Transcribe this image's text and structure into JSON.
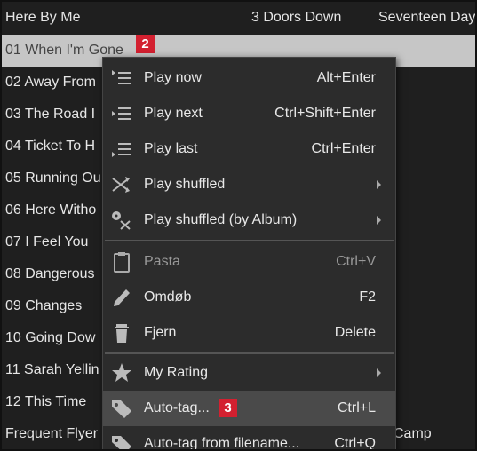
{
  "header": {
    "title": "Here By Me",
    "artist": "3 Doors Down",
    "album": "Seventeen Days"
  },
  "tracks": [
    {
      "title": "01 When I'm Gone"
    },
    {
      "title": "02 Away From"
    },
    {
      "title": "03 The Road I"
    },
    {
      "title": "04 Ticket To H"
    },
    {
      "title": "05 Running Ou"
    },
    {
      "title": "06 Here Witho"
    },
    {
      "title": "07 I Feel You"
    },
    {
      "title": "08 Dangerous"
    },
    {
      "title": "09 Changes"
    },
    {
      "title": "10 Going Dow"
    },
    {
      "title": "11 Sarah Yellin"
    },
    {
      "title": "12 This Time"
    },
    {
      "title": "Frequent Flyer",
      "album": "Camp"
    }
  ],
  "badges": {
    "track_badge": "2",
    "menu_badge": "3"
  },
  "menu": {
    "items": [
      {
        "label": "Play now",
        "shortcut": "Alt+Enter",
        "icon": "play-list-icon"
      },
      {
        "label": "Play next",
        "shortcut": "Ctrl+Shift+Enter",
        "icon": "play-list-icon"
      },
      {
        "label": "Play last",
        "shortcut": "Ctrl+Enter",
        "icon": "play-list-icon"
      },
      {
        "label": "Play shuffled",
        "shortcut": "",
        "icon": "shuffle-icon"
      },
      {
        "label": "Play shuffled (by Album)",
        "shortcut": "",
        "icon": "shuffle-album-icon"
      },
      {
        "label": "Pasta",
        "shortcut": "Ctrl+V",
        "icon": "clipboard-icon"
      },
      {
        "label": "Omdøb",
        "shortcut": "F2",
        "icon": "pencil-icon"
      },
      {
        "label": "Fjern",
        "shortcut": "Delete",
        "icon": "trash-icon"
      },
      {
        "label": "My Rating",
        "shortcut": "",
        "icon": "star-icon"
      },
      {
        "label": "Auto-tag...",
        "shortcut": "Ctrl+L",
        "icon": "tag-icon"
      },
      {
        "label": "Auto-tag from filename...",
        "shortcut": "Ctrl+Q",
        "icon": "tag-icon"
      }
    ]
  },
  "colors": {
    "selected_row": "#c6c6c6",
    "badge": "#d32030",
    "menu_bg": "#2c2c2c"
  }
}
